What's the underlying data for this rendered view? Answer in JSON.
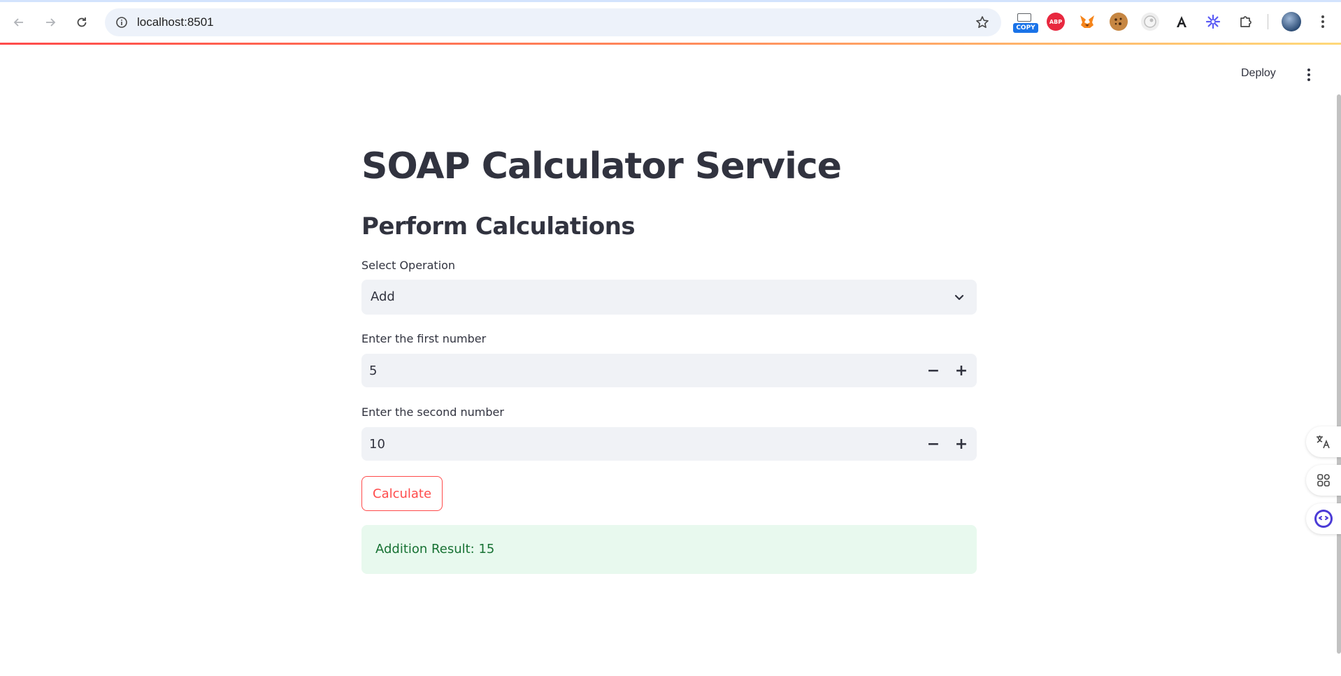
{
  "browser": {
    "url": "localhost:8501",
    "extensions": [
      {
        "name": "copy-extension-icon",
        "label": "COPY",
        "color": "#1a73e8"
      },
      {
        "name": "adblock-icon",
        "label": "ABP",
        "color": "#e8283f"
      },
      {
        "name": "metamask-icon",
        "label": "",
        "color": "#f6851b"
      },
      {
        "name": "cookie-icon",
        "label": "",
        "color": "#a0522d"
      },
      {
        "name": "eye-icon",
        "label": "",
        "color": "#9e9e9e"
      },
      {
        "name": "angular-icon",
        "label": "",
        "color": "#202124"
      },
      {
        "name": "sunburst-icon",
        "label": "",
        "color": "#5b5bf5"
      },
      {
        "name": "puzzle-icon",
        "label": "",
        "color": "#5f6368"
      }
    ]
  },
  "header": {
    "deploy_label": "Deploy"
  },
  "main": {
    "title": "SOAP Calculator Service",
    "subtitle": "Perform Calculations",
    "operation": {
      "label": "Select Operation",
      "value": "Add"
    },
    "first_number": {
      "label": "Enter the first number",
      "value": "5"
    },
    "second_number": {
      "label": "Enter the second number",
      "value": "10"
    },
    "calculate_label": "Calculate",
    "result": "Addition Result: 15"
  },
  "colors": {
    "accent": "#ff4b4b",
    "success_bg": "#e8f9ee",
    "success_text": "#177233",
    "input_bg": "#f0f2f6"
  }
}
